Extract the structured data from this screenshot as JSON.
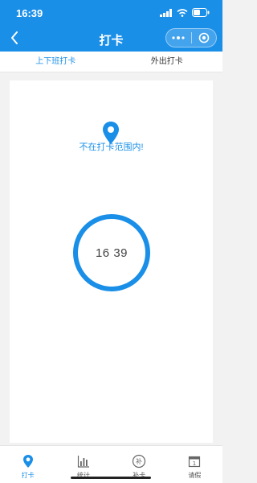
{
  "status": {
    "time": "16:39"
  },
  "header": {
    "title": "打卡"
  },
  "tabs": [
    {
      "label": "上下班打卡"
    },
    {
      "label": "外出打卡"
    }
  ],
  "main": {
    "notice": "不在打卡范围内!",
    "clock_time": "16 39"
  },
  "bottom_nav": [
    {
      "label": "打卡",
      "icon": "location-pin-icon"
    },
    {
      "label": "统计",
      "icon": "bar-chart-icon"
    },
    {
      "label": "补卡",
      "icon": "supplement-icon",
      "glyph": "补"
    },
    {
      "label": "请假",
      "icon": "calendar-icon",
      "glyph": "1"
    }
  ],
  "colors": {
    "primary": "#1a8fe8",
    "background": "#f2f2f2"
  }
}
